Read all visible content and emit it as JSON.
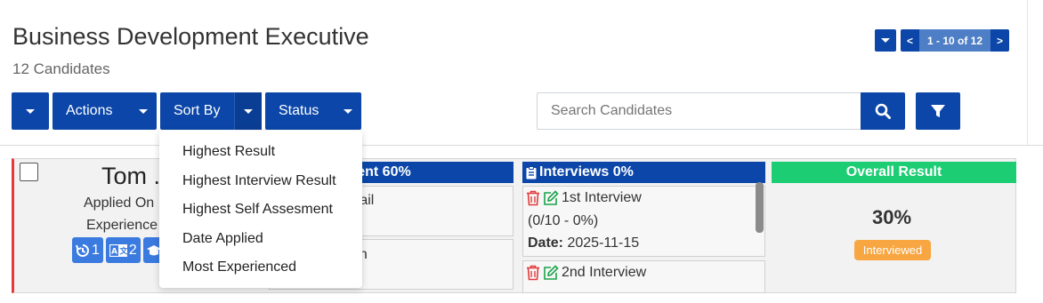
{
  "header": {
    "title": "Business Development Executive",
    "subtitle": "12 Candidates"
  },
  "pagination": {
    "prev_label": "<",
    "range_label": "1 - 10 of 12",
    "next_label": ">"
  },
  "toolbar": {
    "actions_label": "Actions",
    "sort_label": "Sort By",
    "status_label": "Status"
  },
  "search": {
    "placeholder": "Search Candidates"
  },
  "sort_menu": {
    "items": [
      "Highest Result",
      "Highest Interview Result",
      "Highest Self Assesment",
      "Date Applied",
      "Most Experienced"
    ]
  },
  "candidate": {
    "name": "Tom .",
    "applied_on": "Applied On :",
    "experience": "Experience",
    "badges": [
      {
        "icon": "history-icon",
        "count": "1"
      },
      {
        "icon": "language-icon",
        "count": "2"
      },
      {
        "icon": "education-icon",
        "count": ""
      }
    ],
    "assessment_header": "ment 60%",
    "assessment_rows": [
      "etail",
      "on"
    ],
    "interviews_header": "Interviews 0%",
    "interviews": [
      {
        "name": "1st Interview",
        "score": "(0/10 - 0%)",
        "date_label": "Date:",
        "date": "2025-11-15"
      },
      {
        "name": "2nd Interview"
      }
    ],
    "overall_header": "Overall Result",
    "overall_percent": "30%",
    "overall_status": "Interviewed"
  },
  "colors": {
    "primary": "#0b46a8",
    "success": "#1dcd74",
    "warning": "#f7a641",
    "danger": "#e23c3c",
    "edit": "#1aa34a"
  }
}
